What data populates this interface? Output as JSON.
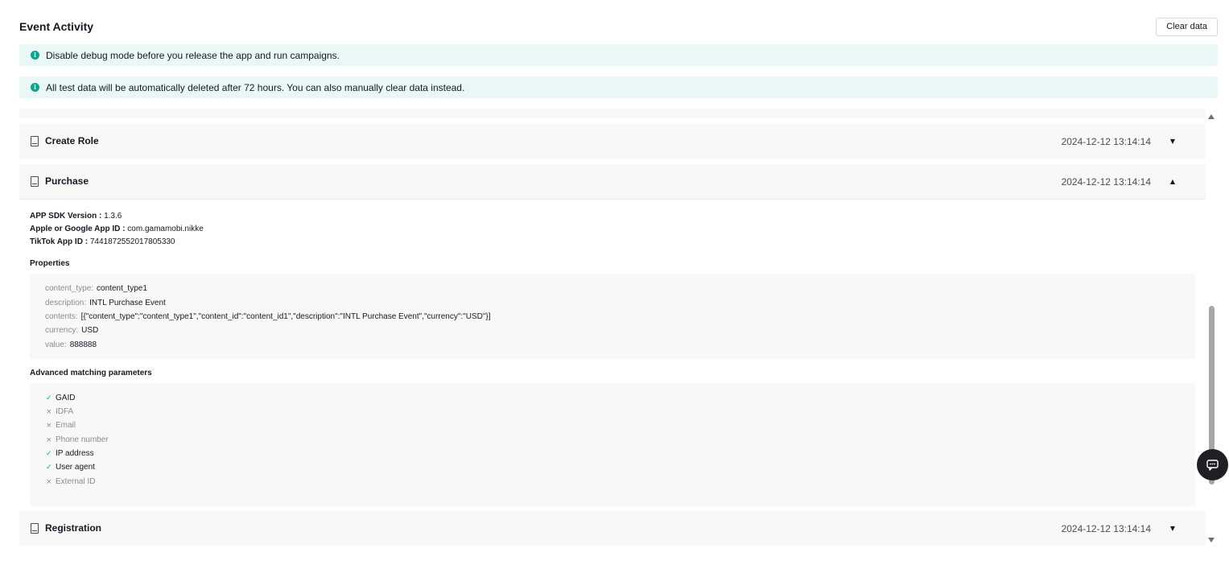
{
  "page": {
    "title": "Event Activity",
    "clear_button": "Clear data"
  },
  "banners": [
    {
      "text": "Disable debug mode before you release the app and run campaigns.",
      "icon": "info-icon"
    },
    {
      "text": "All test data will be automatically deleted after 72 hours. You can also manually clear data instead.",
      "icon": "info-icon"
    }
  ],
  "events": [
    {
      "name": "Create Role",
      "time": "2024-12-12 13:14:14",
      "expanded": false
    },
    {
      "name": "Purchase",
      "time": "2024-12-12 13:14:14",
      "expanded": true
    },
    {
      "name": "Registration",
      "time": "2024-12-12 13:14:14",
      "expanded": false
    }
  ],
  "details": {
    "meta": [
      {
        "key": "APP SDK Version :",
        "value": "1.3.6"
      },
      {
        "key": "Apple or Google App ID :",
        "value": "com.gamamobi.nikke"
      },
      {
        "key": "TikTok App ID :",
        "value": "7441872552017805330"
      }
    ],
    "properties_label": "Properties",
    "properties": [
      {
        "key": "content_type:",
        "value": "content_type1"
      },
      {
        "key": "description:",
        "value": "INTL Purchase Event"
      },
      {
        "key": "contents:",
        "value": "[{\"content_type\":\"content_type1\",\"content_id\":\"content_id1\",\"description\":\"INTL Purchase Event\",\"currency\":\"USD\"}]"
      },
      {
        "key": "currency:",
        "value": "USD"
      },
      {
        "key": "value:",
        "value": "888888"
      }
    ],
    "matching_label": "Advanced matching parameters",
    "matching": [
      {
        "label": "GAID",
        "matched": true
      },
      {
        "label": "IDFA",
        "matched": false
      },
      {
        "label": "Email",
        "matched": false
      },
      {
        "label": "Phone number",
        "matched": false
      },
      {
        "label": "IP address",
        "matched": true
      },
      {
        "label": "User agent",
        "matched": true
      },
      {
        "label": "External ID",
        "matched": false
      }
    ]
  },
  "icons": {
    "matched": "check-icon",
    "unmatched": "cross-icon",
    "event": "document-icon",
    "collapsed": "chevron-down-icon",
    "expanded": "chevron-up-icon",
    "chat": "chat-icon"
  },
  "colors": {
    "accent": "#14a08e",
    "banner_bg": "#e9f8f6",
    "row_bg": "#f8f8f8"
  }
}
